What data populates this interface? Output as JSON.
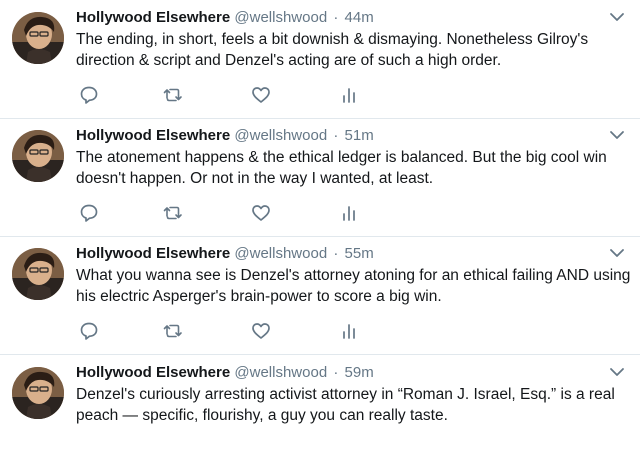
{
  "tweets": [
    {
      "name": "Hollywood Elsewhere",
      "handle": "@wellshwood",
      "separator": "·",
      "time": "44m",
      "text": "The ending, in short, feels a bit downish & dismaying. Nonetheless Gilroy's direction & script and Denzel's acting are of such a high order."
    },
    {
      "name": "Hollywood Elsewhere",
      "handle": "@wellshwood",
      "separator": "·",
      "time": "51m",
      "text": "The atonement happens & the ethical ledger is balanced. But the big cool win doesn't happen.  Or not in the way I wanted, at least."
    },
    {
      "name": "Hollywood Elsewhere",
      "handle": "@wellshwood",
      "separator": "·",
      "time": "55m",
      "text": "What you wanna see is Denzel's attorney atoning for an ethical failing AND using his electric Asperger's brain-power to score a big win."
    },
    {
      "name": "Hollywood Elsewhere",
      "handle": "@wellshwood",
      "separator": "·",
      "time": "59m",
      "text": "Denzel's curiously arresting activist attorney in “Roman J. Israel, Esq.” is a real peach — specific, flourishy, a guy you can really taste."
    }
  ],
  "icons": {
    "reply": "reply-icon",
    "retweet": "retweet-icon",
    "like": "heart-icon",
    "analytics": "analytics-icon",
    "menu": "chevron-down-icon"
  },
  "colors": {
    "text": "#14171a",
    "secondary": "#657786",
    "icon": "#657786",
    "divider": "#e1e8ed",
    "background": "#ffffff"
  }
}
